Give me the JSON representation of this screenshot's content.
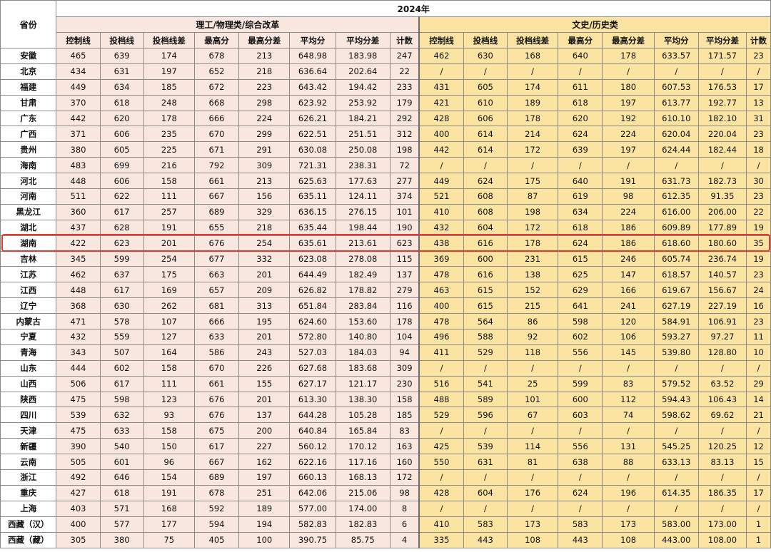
{
  "header": {
    "year": "2024年",
    "province_label": "省份",
    "science_group": "理工/物理类/综合改革",
    "arts_group": "文史/历史类"
  },
  "columns": [
    "控制线",
    "投档线",
    "投档线差",
    "最高分",
    "最高分差",
    "平均分",
    "平均分差",
    "计数"
  ],
  "highlighted_province": "湖南",
  "colors": {
    "science_bg": "#f8e6df",
    "arts_bg": "#fbe4a1",
    "highlight_border": "#e5382f"
  },
  "rows": [
    {
      "province": "安徽",
      "sci": [
        "465",
        "639",
        "174",
        "678",
        "213",
        "648.98",
        "183.98",
        "247"
      ],
      "art": [
        "462",
        "630",
        "168",
        "640",
        "178",
        "633.57",
        "171.57",
        "23"
      ]
    },
    {
      "province": "北京",
      "sci": [
        "434",
        "631",
        "197",
        "652",
        "218",
        "636.64",
        "202.64",
        "22"
      ],
      "art": [
        "/",
        "/",
        "/",
        "/",
        "/",
        "/",
        "/",
        "/"
      ]
    },
    {
      "province": "福建",
      "sci": [
        "449",
        "634",
        "185",
        "672",
        "223",
        "643.42",
        "194.42",
        "233"
      ],
      "art": [
        "431",
        "605",
        "174",
        "611",
        "180",
        "607.53",
        "176.53",
        "17"
      ]
    },
    {
      "province": "甘肃",
      "sci": [
        "370",
        "618",
        "248",
        "668",
        "298",
        "623.92",
        "253.92",
        "179"
      ],
      "art": [
        "421",
        "610",
        "189",
        "618",
        "197",
        "613.77",
        "192.77",
        "13"
      ]
    },
    {
      "province": "广东",
      "sci": [
        "442",
        "620",
        "178",
        "666",
        "224",
        "626.21",
        "184.21",
        "292"
      ],
      "art": [
        "428",
        "606",
        "178",
        "620",
        "192",
        "610.10",
        "182.10",
        "31"
      ]
    },
    {
      "province": "广西",
      "sci": [
        "371",
        "606",
        "235",
        "670",
        "299",
        "622.51",
        "251.51",
        "312"
      ],
      "art": [
        "400",
        "614",
        "214",
        "624",
        "224",
        "620.04",
        "220.04",
        "23"
      ]
    },
    {
      "province": "贵州",
      "sci": [
        "380",
        "605",
        "225",
        "671",
        "291",
        "630.08",
        "250.08",
        "198"
      ],
      "art": [
        "442",
        "614",
        "172",
        "639",
        "197",
        "624.44",
        "182.44",
        "18"
      ]
    },
    {
      "province": "海南",
      "sci": [
        "483",
        "699",
        "216",
        "792",
        "309",
        "721.31",
        "238.31",
        "72"
      ],
      "art": [
        "/",
        "/",
        "/",
        "/",
        "/",
        "/",
        "/",
        "/"
      ]
    },
    {
      "province": "河北",
      "sci": [
        "448",
        "606",
        "158",
        "661",
        "213",
        "625.63",
        "177.63",
        "277"
      ],
      "art": [
        "449",
        "624",
        "175",
        "640",
        "191",
        "631.73",
        "182.73",
        "30"
      ]
    },
    {
      "province": "河南",
      "sci": [
        "511",
        "622",
        "111",
        "667",
        "156",
        "635.11",
        "124.11",
        "374"
      ],
      "art": [
        "521",
        "608",
        "87",
        "619",
        "98",
        "612.35",
        "91.35",
        "23"
      ]
    },
    {
      "province": "黑龙江",
      "sci": [
        "360",
        "617",
        "257",
        "689",
        "329",
        "636.15",
        "276.15",
        "101"
      ],
      "art": [
        "410",
        "608",
        "198",
        "634",
        "224",
        "616.00",
        "206.00",
        "22"
      ]
    },
    {
      "province": "湖北",
      "sci": [
        "437",
        "628",
        "191",
        "655",
        "218",
        "635.44",
        "198.44",
        "190"
      ],
      "art": [
        "432",
        "604",
        "172",
        "618",
        "186",
        "609.89",
        "177.89",
        "19"
      ]
    },
    {
      "province": "湖南",
      "sci": [
        "422",
        "623",
        "201",
        "676",
        "254",
        "635.61",
        "213.61",
        "623"
      ],
      "art": [
        "438",
        "616",
        "178",
        "624",
        "186",
        "618.60",
        "180.60",
        "35"
      ]
    },
    {
      "province": "吉林",
      "sci": [
        "345",
        "599",
        "254",
        "677",
        "332",
        "623.08",
        "278.08",
        "115"
      ],
      "art": [
        "369",
        "600",
        "231",
        "615",
        "246",
        "605.74",
        "236.74",
        "19"
      ]
    },
    {
      "province": "江苏",
      "sci": [
        "462",
        "637",
        "175",
        "663",
        "201",
        "644.49",
        "182.49",
        "137"
      ],
      "art": [
        "478",
        "616",
        "138",
        "625",
        "147",
        "618.57",
        "140.57",
        "23"
      ]
    },
    {
      "province": "江西",
      "sci": [
        "448",
        "617",
        "169",
        "657",
        "209",
        "626.82",
        "178.82",
        "279"
      ],
      "art": [
        "463",
        "615",
        "152",
        "629",
        "166",
        "619.67",
        "156.67",
        "24"
      ]
    },
    {
      "province": "辽宁",
      "sci": [
        "368",
        "630",
        "262",
        "681",
        "313",
        "651.84",
        "283.84",
        "116"
      ],
      "art": [
        "400",
        "615",
        "215",
        "641",
        "241",
        "627.19",
        "227.19",
        "16"
      ]
    },
    {
      "province": "内蒙古",
      "sci": [
        "471",
        "578",
        "107",
        "666",
        "195",
        "624.60",
        "153.60",
        "178"
      ],
      "art": [
        "478",
        "564",
        "86",
        "598",
        "120",
        "584.91",
        "106.91",
        "23"
      ]
    },
    {
      "province": "宁夏",
      "sci": [
        "432",
        "559",
        "127",
        "633",
        "201",
        "572.80",
        "140.80",
        "104"
      ],
      "art": [
        "496",
        "588",
        "92",
        "602",
        "106",
        "593.27",
        "97.27",
        "11"
      ]
    },
    {
      "province": "青海",
      "sci": [
        "343",
        "507",
        "164",
        "586",
        "243",
        "527.03",
        "184.03",
        "94"
      ],
      "art": [
        "411",
        "529",
        "118",
        "556",
        "145",
        "539.80",
        "128.80",
        "10"
      ]
    },
    {
      "province": "山东",
      "sci": [
        "444",
        "602",
        "158",
        "670",
        "226",
        "627.68",
        "183.68",
        "309"
      ],
      "art": [
        "/",
        "/",
        "/",
        "/",
        "/",
        "/",
        "/",
        "/"
      ]
    },
    {
      "province": "山西",
      "sci": [
        "506",
        "617",
        "111",
        "661",
        "155",
        "627.17",
        "121.17",
        "230"
      ],
      "art": [
        "516",
        "541",
        "25",
        "599",
        "83",
        "579.52",
        "63.52",
        "29"
      ]
    },
    {
      "province": "陕西",
      "sci": [
        "475",
        "598",
        "123",
        "676",
        "201",
        "613.30",
        "138.30",
        "158"
      ],
      "art": [
        "488",
        "589",
        "101",
        "600",
        "112",
        "594.43",
        "106.43",
        "14"
      ]
    },
    {
      "province": "四川",
      "sci": [
        "539",
        "632",
        "93",
        "676",
        "137",
        "644.28",
        "105.28",
        "185"
      ],
      "art": [
        "529",
        "596",
        "67",
        "603",
        "74",
        "598.62",
        "69.62",
        "21"
      ]
    },
    {
      "province": "天津",
      "sci": [
        "475",
        "633",
        "158",
        "675",
        "200",
        "640.84",
        "165.84",
        "83"
      ],
      "art": [
        "/",
        "/",
        "/",
        "/",
        "/",
        "/",
        "/",
        "/"
      ]
    },
    {
      "province": "新疆",
      "sci": [
        "390",
        "540",
        "150",
        "617",
        "227",
        "560.12",
        "170.12",
        "163"
      ],
      "art": [
        "425",
        "539",
        "114",
        "556",
        "131",
        "545.25",
        "120.25",
        "12"
      ]
    },
    {
      "province": "云南",
      "sci": [
        "505",
        "601",
        "96",
        "667",
        "162",
        "622.16",
        "117.16",
        "160"
      ],
      "art": [
        "550",
        "631",
        "81",
        "638",
        "88",
        "633.13",
        "83.13",
        "15"
      ]
    },
    {
      "province": "浙江",
      "sci": [
        "492",
        "646",
        "154",
        "689",
        "197",
        "660.13",
        "168.13",
        "172"
      ],
      "art": [
        "/",
        "/",
        "/",
        "/",
        "/",
        "/",
        "/",
        "/"
      ]
    },
    {
      "province": "重庆",
      "sci": [
        "427",
        "618",
        "191",
        "678",
        "251",
        "642.06",
        "215.06",
        "98"
      ],
      "art": [
        "428",
        "604",
        "176",
        "624",
        "196",
        "614.35",
        "186.35",
        "17"
      ]
    },
    {
      "province": "上海",
      "sci": [
        "403",
        "571",
        "168",
        "592",
        "189",
        "577.00",
        "174.00",
        "8"
      ],
      "art": [
        "/",
        "/",
        "/",
        "/",
        "/",
        "/",
        "/",
        "/"
      ]
    },
    {
      "province": "西藏（汉）",
      "sci": [
        "400",
        "577",
        "177",
        "594",
        "194",
        "582.83",
        "182.83",
        "6"
      ],
      "art": [
        "410",
        "583",
        "173",
        "583",
        "173",
        "583.00",
        "173.00",
        "1"
      ]
    },
    {
      "province": "西藏（藏）",
      "sci": [
        "305",
        "380",
        "75",
        "405",
        "100",
        "390.75",
        "85.75",
        "4"
      ],
      "art": [
        "335",
        "443",
        "108",
        "443",
        "108",
        "443.00",
        "108.00",
        "1"
      ]
    }
  ]
}
